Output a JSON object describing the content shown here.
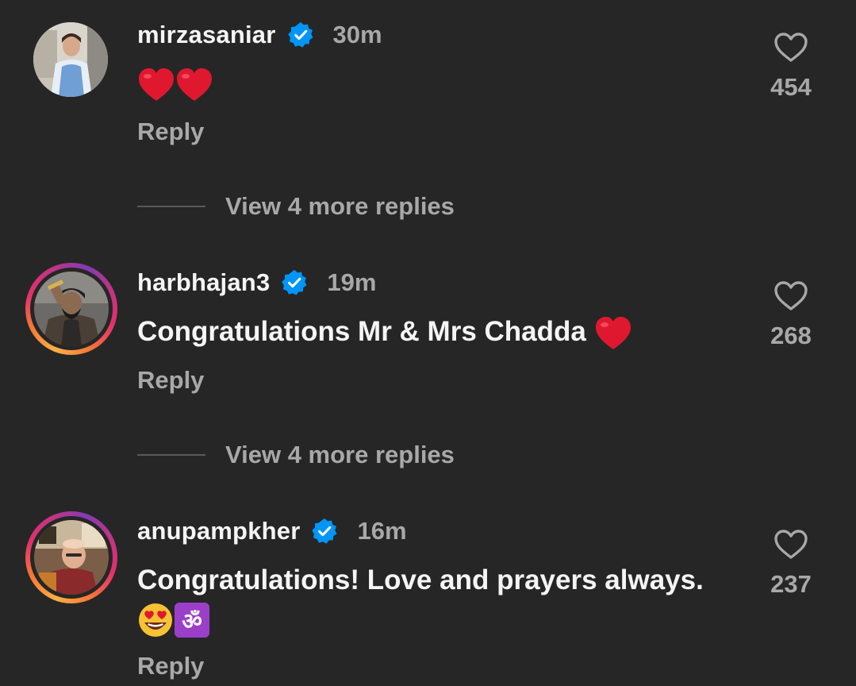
{
  "comments": [
    {
      "username": "mirzasaniar",
      "time": "30m",
      "text": "",
      "emojis": [
        "red-heart",
        "red-heart"
      ],
      "reply_label": "Reply",
      "likes": "454",
      "view_more": "View 4 more replies",
      "story_ring": false
    },
    {
      "username": "harbhajan3",
      "time": "19m",
      "text": "Congratulations Mr & Mrs Chadda",
      "emojis": [
        "red-heart"
      ],
      "reply_label": "Reply",
      "likes": "268",
      "view_more": "View 4 more replies",
      "story_ring": true
    },
    {
      "username": "anupampkher",
      "time": "16m",
      "text": "Congratulations! Love and prayers always.",
      "emojis": [
        "heart-eyes-face",
        "om-symbol"
      ],
      "reply_label": "Reply",
      "likes": "237",
      "story_ring": true
    }
  ],
  "colors": {
    "background": "#262626",
    "primary_text": "#f5f5f5",
    "secondary_text": "#a8a8a8",
    "verified_blue": "#0095f6",
    "heart_red": "#e0182f"
  },
  "icons": {
    "verified": "verified-badge-icon",
    "like": "heart-outline-icon"
  }
}
